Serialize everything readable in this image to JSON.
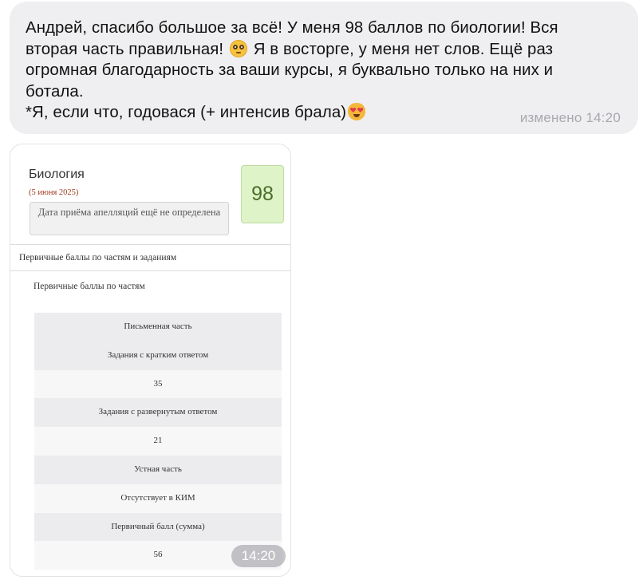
{
  "message": {
    "lines": [
      "Андрей, спасибо большое за всё! У меня 98 баллов по биологии! Вся",
      "вторая часть правильная!",
      "Я в восторге, у меня нет слов. Ещё раз",
      "огромная благодарность за ваши курсы, я буквально только на них и",
      "ботала.",
      "*Я, если что, годовася (+ интенсив брала)"
    ],
    "emoji_1": "flushed-face-emoji",
    "emoji_2": "heart-eyes-cat-emoji",
    "edited_label": "изменено 14:20"
  },
  "result_card": {
    "subject": "Биология",
    "date": "(5 июня 2025)",
    "appeal_note": "Дата приёма апелляций ещё не определена",
    "score": "98",
    "section_heading": "Первичные баллы по частям и заданиям",
    "parts_title": "Первичные баллы по частям",
    "rows": [
      "Письменная часть",
      "Задания с кратким ответом",
      "35",
      "Задания с развернутым ответом",
      "21",
      "Устная часть",
      "Отсутствует в КИМ",
      "Первичный балл (сумма)",
      "56"
    ],
    "time": "14:20"
  },
  "colors": {
    "bubble_bg": "#efeff1",
    "score_bg": "#dff3c8",
    "date_red": "#a33a1f"
  }
}
